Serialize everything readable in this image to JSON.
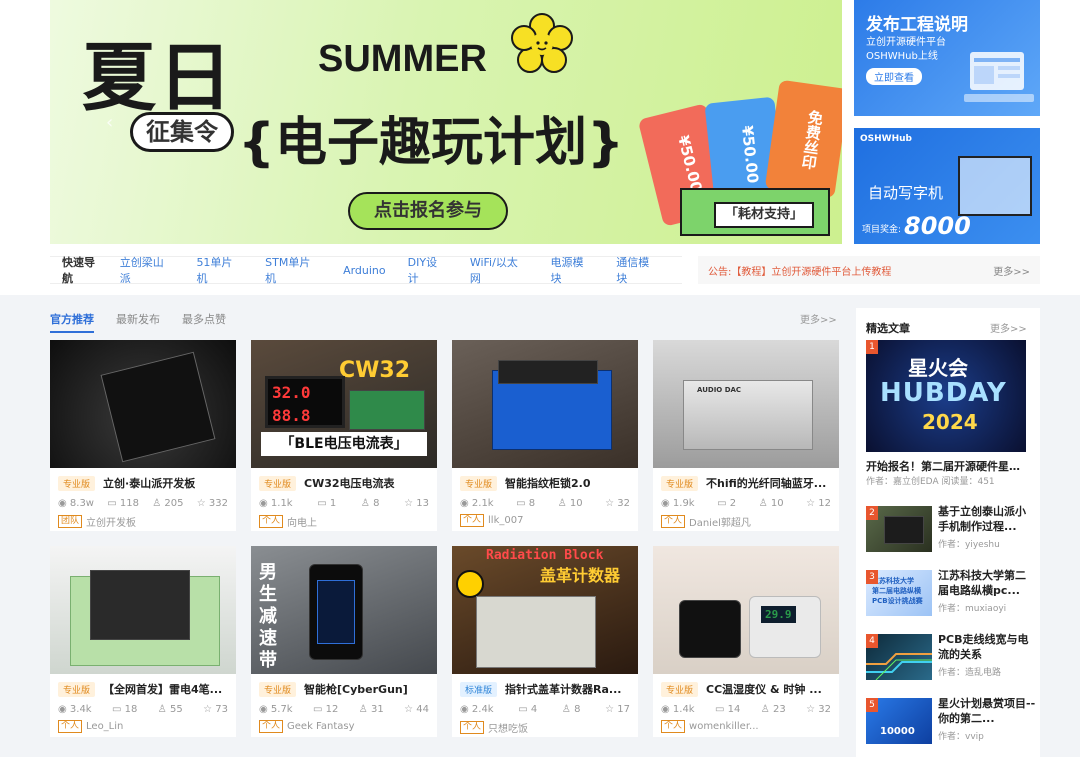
{
  "banner": {
    "big": "夏日",
    "summer": "SUMMER",
    "tag": "征集令",
    "main": "{电子趣玩计划}",
    "cta": "点击报名参与",
    "tickets": [
      "¥50.00",
      "¥50.00",
      "免费丝印"
    ],
    "box_label": "「耗材支持」",
    "arrow": "‹"
  },
  "side_ads": [
    {
      "title": "发布工程说明",
      "sub1": "立创开源硬件平台",
      "sub2": "OSHWHub上线",
      "button": "立即查看"
    },
    {
      "logo": "OSHWHub",
      "title": "自动写字机",
      "prize_label": "项目奖金:",
      "prize": "8000"
    }
  ],
  "quicknav": {
    "label": "快速导航",
    "links": [
      "立创梁山派",
      "51单片机",
      "STM单片机",
      "Arduino",
      "DIY设计",
      "WiFi/以太网",
      "电源模块",
      "通信模块"
    ]
  },
  "notice": {
    "text": "公告:【教程】立创开源硬件平台上传教程",
    "more": "更多>>"
  },
  "tabs": [
    "官方推荐",
    "最新发布",
    "最多点赞"
  ],
  "tabs_more": "更多>>",
  "projects": [
    {
      "badge": "专业版",
      "title": "立创·泰山派开发板",
      "views": "8.3w",
      "favs": "118",
      "likes": "205",
      "stars": "332",
      "tag": "团队",
      "author": "立创开发板"
    },
    {
      "badge": "专业版",
      "title": "CW32电压电流表",
      "views": "1.1k",
      "favs": "1",
      "likes": "8",
      "stars": "13",
      "tag": "个人",
      "author": "向电上"
    },
    {
      "badge": "专业版",
      "title": "智能指纹柜锁2.0",
      "views": "2.1k",
      "favs": "8",
      "likes": "10",
      "stars": "32",
      "tag": "个人",
      "author": "llk_007"
    },
    {
      "badge": "专业版",
      "title": "不hifi的光纤同轴蓝牙...",
      "views": "1.9k",
      "favs": "2",
      "likes": "10",
      "stars": "12",
      "tag": "个人",
      "author": "Daniel郭超凡"
    },
    {
      "badge": "专业版",
      "title": "【全网首发】雷电4笔...",
      "views": "3.4k",
      "favs": "18",
      "likes": "55",
      "stars": "73",
      "tag": "个人",
      "author": "Leo_Lin"
    },
    {
      "badge": "专业版",
      "title": "智能枪[CyberGun]",
      "views": "5.7k",
      "favs": "12",
      "likes": "31",
      "stars": "44",
      "tag": "个人",
      "author": "Geek Fantasy"
    },
    {
      "badge": "标准版",
      "title": "指针式盖革计数器Ra...",
      "views": "2.4k",
      "favs": "4",
      "likes": "8",
      "stars": "17",
      "tag": "个人",
      "author": "只想吃饭"
    },
    {
      "badge": "专业版",
      "title": "CC温湿度仪 & 时钟 ...",
      "views": "1.4k",
      "favs": "14",
      "likes": "23",
      "stars": "32",
      "tag": "个人",
      "author": "womenkiller..."
    }
  ],
  "image_text": {
    "cw32": "CW32",
    "cw32_caption": "「BLE电压电流表」",
    "cw32_v": "32.0",
    "cw32_a": "88.8",
    "dac": "AUDIO DAC",
    "cyber_side": "男生减速带",
    "rad_title": "Radiation Block",
    "rad_sub": "盖革计数器",
    "cc_temp": "29.9"
  },
  "sidebar": {
    "header": "精选文章",
    "more": "更多>>",
    "featured": {
      "rank": "1",
      "img_l1": "星火会",
      "img_l2": "HUBDAY",
      "img_l3": "2024",
      "title": "开始报名！第二届开源硬件星火...",
      "meta": "作者：嘉立创EDA    阅读量：451"
    },
    "articles": [
      {
        "rank": "2",
        "title": "基于立创泰山派小手机制作过程...",
        "meta": "作者：yiyeshu"
      },
      {
        "rank": "3",
        "title": "江苏科技大学第二届电路纵横pc...",
        "meta": "作者：muxiaoyi"
      },
      {
        "rank": "4",
        "title": "PCB走线线宽与电流的关系",
        "meta": "作者：造乱电路"
      },
      {
        "rank": "5",
        "title": "星火计划悬赏项目--你的第二...",
        "meta": "作者：vvip"
      }
    ],
    "art3_img_l1": "江苏科技大学",
    "art3_img_l2": "第二届电路纵横",
    "art3_img_l3": "PCB设计挑战赛",
    "art5_img": "10000"
  },
  "colors": {
    "accent": "#2f6fd8",
    "pro_badge": "#e08a1e",
    "rank": "#e8562e",
    "banner_green": "#cdf08f"
  }
}
